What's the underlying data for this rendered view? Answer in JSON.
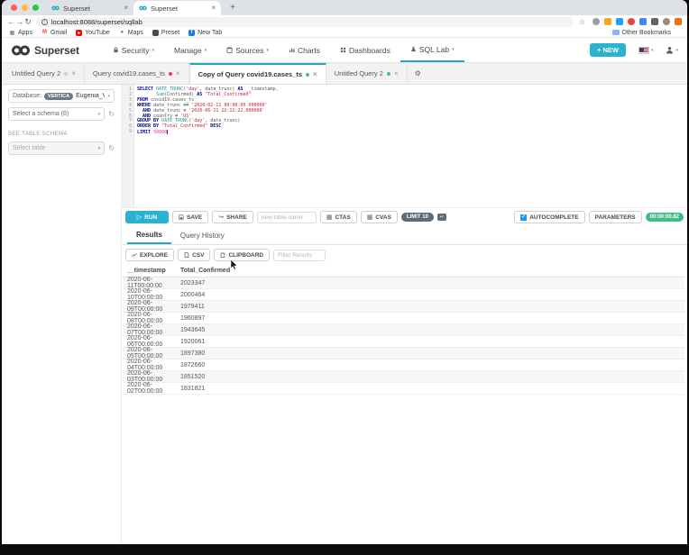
{
  "browser": {
    "tabs": [
      {
        "title": "Superset"
      },
      {
        "title": "Superset"
      }
    ],
    "url": "localhost:8088/superset/sqllab",
    "bookmarks": [
      {
        "label": "Apps",
        "icon": "apps-grid-icon"
      },
      {
        "label": "Gmail",
        "icon": "gmail-icon"
      },
      {
        "label": "YouTube",
        "icon": "youtube-icon"
      },
      {
        "label": "Maps",
        "icon": "maps-pin-icon"
      },
      {
        "label": "Preset",
        "icon": "preset-icon"
      },
      {
        "label": "New Tab",
        "icon": "facebook-icon"
      }
    ],
    "other_bookmarks": "Other Bookmarks",
    "extension_colors": [
      "#9aa0a6",
      "#f5a623",
      "#1da1f2",
      "#e8453c",
      "#4285f4",
      "#5f6368",
      "#a1887f",
      "#e8710a"
    ]
  },
  "navbar": {
    "brand": "Superset",
    "items": [
      {
        "label": "Security",
        "icon": "lock-icon",
        "caret": true
      },
      {
        "label": "Manage",
        "caret": true
      },
      {
        "label": "Sources",
        "icon": "database-icon",
        "caret": true
      },
      {
        "label": "Charts",
        "icon": "chart-icon"
      },
      {
        "label": "Dashboards",
        "icon": "dashboard-icon"
      },
      {
        "label": "SQL Lab",
        "icon": "flask-icon",
        "caret": true,
        "active": true
      }
    ],
    "new_button": "+ NEW"
  },
  "query_tabs": [
    {
      "label": "Untitled Query 2",
      "status": "grey"
    },
    {
      "label": "Query covid19.cases_ts",
      "status": "red"
    },
    {
      "label": "Copy of Query covid19.cases_ts",
      "status": "green",
      "active": true
    },
    {
      "label": "Untitled Query 2",
      "status": "green"
    }
  ],
  "sidebar": {
    "database_label": "Database:",
    "database_badge": "VERTICA",
    "database_value": "Eugenia_Verti",
    "schema_placeholder": "Select a schema (6)",
    "see_table_schema": "SEE TABLE SCHEMA",
    "table_placeholder": "Select table"
  },
  "editor": {
    "lines": [
      [
        {
          "c": "kw",
          "t": "SELECT "
        },
        {
          "c": "fn",
          "t": "DATE_TRUNC"
        },
        {
          "c": "pl",
          "t": "("
        },
        {
          "c": "str",
          "t": "'day'"
        },
        {
          "c": "pl",
          "t": ", "
        },
        {
          "c": "id",
          "t": "date_trunc"
        },
        {
          "c": "pl",
          "t": ") "
        },
        {
          "c": "kw",
          "t": "AS "
        },
        {
          "c": "id",
          "t": "__timestamp,"
        }
      ],
      [
        {
          "c": "pl",
          "t": "       "
        },
        {
          "c": "fn",
          "t": "Sum"
        },
        {
          "c": "pl",
          "t": "("
        },
        {
          "c": "id",
          "t": "Confirmed"
        },
        {
          "c": "pl",
          "t": ") "
        },
        {
          "c": "kw",
          "t": "AS "
        },
        {
          "c": "str",
          "t": "\"Total_Confirmed\""
        }
      ],
      [
        {
          "c": "kw",
          "t": "FROM "
        },
        {
          "c": "id",
          "t": "covid19.cases_ts"
        }
      ],
      [
        {
          "c": "kw",
          "t": "WHERE "
        },
        {
          "c": "id",
          "t": "date_trunc "
        },
        {
          "c": "op",
          "t": ">= "
        },
        {
          "c": "str",
          "t": "'2020-02-11 00:00:00.000000'"
        }
      ],
      [
        {
          "c": "pl",
          "t": "  "
        },
        {
          "c": "kw",
          "t": "AND "
        },
        {
          "c": "id",
          "t": "date_trunc "
        },
        {
          "c": "op",
          "t": "< "
        },
        {
          "c": "str",
          "t": "'2020-06-11 22:11:22.000000'"
        }
      ],
      [
        {
          "c": "pl",
          "t": "  "
        },
        {
          "c": "kw",
          "t": "AND "
        },
        {
          "c": "id",
          "t": "country "
        },
        {
          "c": "op",
          "t": "= "
        },
        {
          "c": "str",
          "t": "'US'"
        }
      ],
      [
        {
          "c": "kw",
          "t": "GROUP BY "
        },
        {
          "c": "fn",
          "t": "DATE_TRUNC"
        },
        {
          "c": "pl",
          "t": "("
        },
        {
          "c": "str",
          "t": "'day'"
        },
        {
          "c": "pl",
          "t": ", "
        },
        {
          "c": "id",
          "t": "date_trunc"
        },
        {
          "c": "pl",
          "t": ")"
        }
      ],
      [
        {
          "c": "kw",
          "t": "ORDER BY "
        },
        {
          "c": "str",
          "t": "\"Total_Confirmed\" "
        },
        {
          "c": "kw",
          "t": "DESC"
        }
      ],
      [
        {
          "c": "kw",
          "t": "LIMIT "
        },
        {
          "c": "num",
          "t": "50000"
        }
      ]
    ]
  },
  "toolbar": {
    "run_label": "RUN",
    "save_label": "SAVE",
    "share_label": "SHARE",
    "new_table_placeholder": "new table name",
    "ctas_label": "CTAS",
    "cvas_label": "CVAS",
    "limit_label": "LIMIT 10",
    "autocomplete_label": "AUTOCOMPLETE",
    "parameters_label": "PARAMETERS",
    "timer": "00:00:00.82"
  },
  "results": {
    "tabs": [
      {
        "label": "Results",
        "active": true
      },
      {
        "label": "Query History"
      }
    ],
    "actions": [
      "EXPLORE",
      "CSV",
      "CLIPBOARD"
    ],
    "filter_placeholder": "Filter Results",
    "columns": [
      "__timestamp",
      "Total_Confirmed"
    ],
    "rows": [
      [
        "2020-06-11T00:00:00",
        "2023347"
      ],
      [
        "2020-06-10T00:00:00",
        "2000464"
      ],
      [
        "2020-06-09T00:00:00",
        "1979411"
      ],
      [
        "2020-06-08T00:00:00",
        "1960897"
      ],
      [
        "2020-06-07T00:00:00",
        "1943645"
      ],
      [
        "2020-06-06T00:00:00",
        "1920061"
      ],
      [
        "2020-06-05T00:00:00",
        "1897380"
      ],
      [
        "2020-06-04T00:00:00",
        "1872660"
      ],
      [
        "2020-06-03T00:00:00",
        "1851520"
      ],
      [
        "2020-06-02T00:00:00",
        "1831821"
      ]
    ]
  },
  "colors": {
    "brand": "#20a7c9",
    "run_button": "#2cb2cf",
    "timer_badge": "#44bb87",
    "limit_badge": "#5f6b76",
    "status": {
      "grey": "#cccccc",
      "red": "#e04355",
      "green": "#44c08a"
    },
    "traffic": [
      "#ff5f57",
      "#febc2e",
      "#28c840"
    ]
  }
}
